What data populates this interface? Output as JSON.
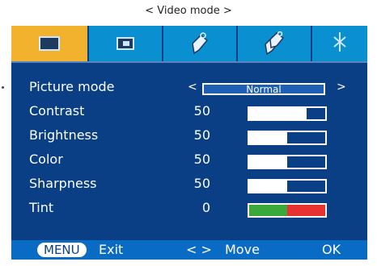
{
  "caption": "< Video mode >",
  "tabs": [
    {
      "icon": "picture-icon",
      "active": true
    },
    {
      "icon": "screen-icon",
      "active": false
    },
    {
      "icon": "tag-icon",
      "active": false
    },
    {
      "icon": "tags-icon",
      "active": false
    },
    {
      "icon": "setup-icon",
      "active": false
    }
  ],
  "picture_mode": {
    "label": "Picture mode",
    "value": "Normal",
    "left_arrow": "<",
    "right_arrow": ">"
  },
  "settings": [
    {
      "label": "Contrast",
      "value": "50",
      "level": 0.75
    },
    {
      "label": "Brightness",
      "value": "50",
      "level": 0.5
    },
    {
      "label": "Color",
      "value": "50",
      "level": 0.5
    },
    {
      "label": "Sharpness",
      "value": "50",
      "level": 0.5
    }
  ],
  "tint": {
    "label": "Tint",
    "value": "0",
    "green_color": "#3aa83a",
    "red_color": "#e83232"
  },
  "footer": {
    "menu_key": "MENU",
    "exit_label": "Exit",
    "move_keys": "< >",
    "move_label": "Move",
    "ok_label": "OK"
  },
  "colors": {
    "panel": "#0a3f86",
    "tab_bar": "#0a8fd0",
    "active_tab": "#f2b22e"
  }
}
